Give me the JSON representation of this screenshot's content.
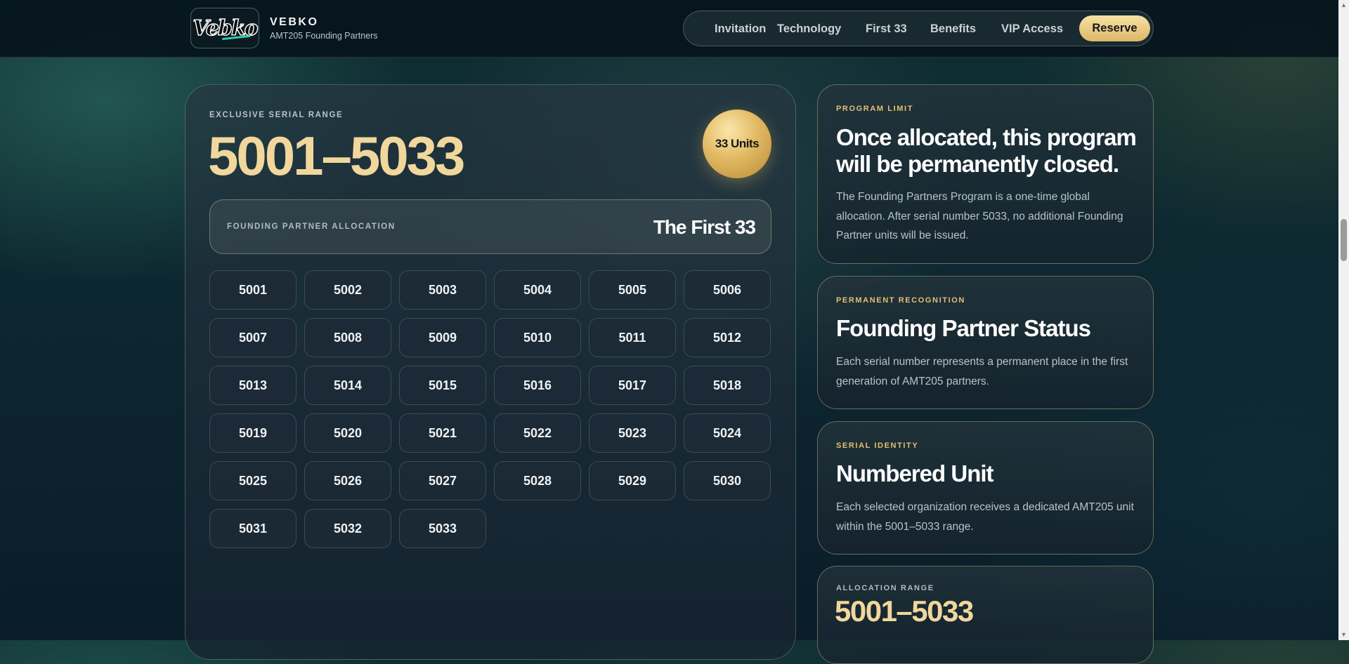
{
  "header": {
    "logo_text": "Vebko",
    "brand_title": "VEBKO",
    "brand_subtitle": "AMT205 Founding Partners",
    "nav": [
      "Invitation",
      "Technology",
      "First 33",
      "Benefits",
      "VIP Access"
    ],
    "reserve_label": "Reserve"
  },
  "main": {
    "eyebrow": "Exclusive Serial Range",
    "range": "5001–5033",
    "units_badge": "33 Units",
    "allocation_label": "Founding Partner Allocation",
    "allocation_value": "The First 33",
    "serials": [
      "5001",
      "5002",
      "5003",
      "5004",
      "5005",
      "5006",
      "5007",
      "5008",
      "5009",
      "5010",
      "5011",
      "5012",
      "5013",
      "5014",
      "5015",
      "5016",
      "5017",
      "5018",
      "5019",
      "5020",
      "5021",
      "5022",
      "5023",
      "5024",
      "5025",
      "5026",
      "5027",
      "5028",
      "5029",
      "5030",
      "5031",
      "5032",
      "5033"
    ]
  },
  "cards": [
    {
      "eyebrow": "Program Limit",
      "title": "Once allocated, this program will be permanently closed.",
      "body": "The Founding Partners Program is a one-time global allocation. After serial number 5033, no additional Founding Partner units will be issued."
    },
    {
      "eyebrow": "Permanent Recognition",
      "title": "Founding Partner Status",
      "body": "Each serial number represents a permanent place in the first generation of AMT205 partners."
    },
    {
      "eyebrow": "Serial Identity",
      "title": "Numbered Unit",
      "body": "Each selected organization receives a dedicated AMT205 unit within the 5001–5033 range."
    }
  ],
  "allocation_card": {
    "eyebrow": "Allocation Range",
    "range": "5001–5033"
  },
  "colors": {
    "gold": "#f1d79c",
    "accent_gold": "#e4c06f",
    "button_gold": "#dcb767"
  }
}
